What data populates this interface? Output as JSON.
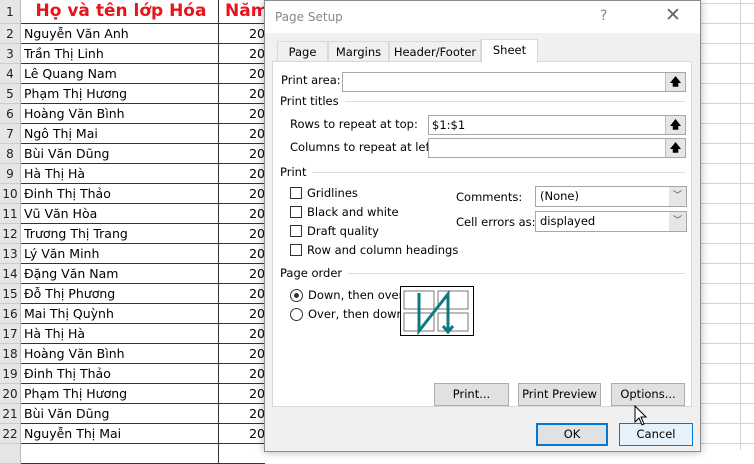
{
  "sheet": {
    "header": {
      "row": "1",
      "col_a": "Họ và tên lớp Hóa",
      "col_b": "Năm"
    },
    "rows": [
      {
        "n": "2",
        "name": "Nguyễn Văn Anh",
        "year": "20"
      },
      {
        "n": "3",
        "name": "Trần Thị Linh",
        "year": "20"
      },
      {
        "n": "4",
        "name": "Lê Quang Nam",
        "year": "20"
      },
      {
        "n": "5",
        "name": "Phạm Thị Hương",
        "year": "20"
      },
      {
        "n": "6",
        "name": "Hoàng Văn Bình",
        "year": "20"
      },
      {
        "n": "7",
        "name": "Ngô Thị Mai",
        "year": "20"
      },
      {
        "n": "8",
        "name": "Bùi Văn Dũng",
        "year": "20"
      },
      {
        "n": "9",
        "name": "Hà Thị Hà",
        "year": "20"
      },
      {
        "n": "10",
        "name": "Đinh Thị Thảo",
        "year": "20"
      },
      {
        "n": "11",
        "name": "Vũ Văn Hòa",
        "year": "20"
      },
      {
        "n": "12",
        "name": "Trương Thị Trang",
        "year": "20"
      },
      {
        "n": "13",
        "name": "Lý Văn Minh",
        "year": "20"
      },
      {
        "n": "14",
        "name": "Đặng Văn Nam",
        "year": "20"
      },
      {
        "n": "15",
        "name": "Đỗ Thị Phương",
        "year": "20"
      },
      {
        "n": "16",
        "name": "Mai Thị Quỳnh",
        "year": "20"
      },
      {
        "n": "17",
        "name": "Hà Thị Hà",
        "year": "20"
      },
      {
        "n": "18",
        "name": "Hoàng Văn Bình",
        "year": "20"
      },
      {
        "n": "19",
        "name": "Đinh Thị Thảo",
        "year": "20"
      },
      {
        "n": "20",
        "name": "Phạm Thị Hương",
        "year": "20"
      },
      {
        "n": "21",
        "name": "Bùi Văn Dũng",
        "year": "20"
      },
      {
        "n": "22",
        "name": "Nguyễn Thị Mai",
        "year": "20"
      }
    ]
  },
  "dialog": {
    "title": "Page Setup",
    "help": "?",
    "close": "✕",
    "tabs": [
      "Page",
      "Margins",
      "Header/Footer",
      "Sheet"
    ],
    "print_area_label": "Print area:",
    "print_area_value": "",
    "print_titles_label": "Print titles",
    "rows_repeat_label": "Rows to repeat at top:",
    "rows_repeat_value": "$1:$1",
    "cols_repeat_label": "Columns to repeat at left:",
    "cols_repeat_value": "",
    "print_label": "Print",
    "checkboxes": [
      {
        "label": "Gridlines",
        "checked": false
      },
      {
        "label": "Black and white",
        "checked": false
      },
      {
        "label": "Draft quality",
        "checked": false
      },
      {
        "label": "Row and column headings",
        "checked": false
      }
    ],
    "comments_label": "Comments:",
    "comments_value": "(None)",
    "cell_errors_label": "Cell errors as:",
    "cell_errors_value": "displayed",
    "page_order_label": "Page order",
    "radios": [
      {
        "label": "Down, then over",
        "selected": true
      },
      {
        "label": "Over, then down",
        "selected": false
      }
    ],
    "buttons": {
      "print": "Print...",
      "preview": "Print Preview",
      "options": "Options...",
      "ok": "OK",
      "cancel": "Cancel"
    },
    "accent": "#0078d7"
  }
}
